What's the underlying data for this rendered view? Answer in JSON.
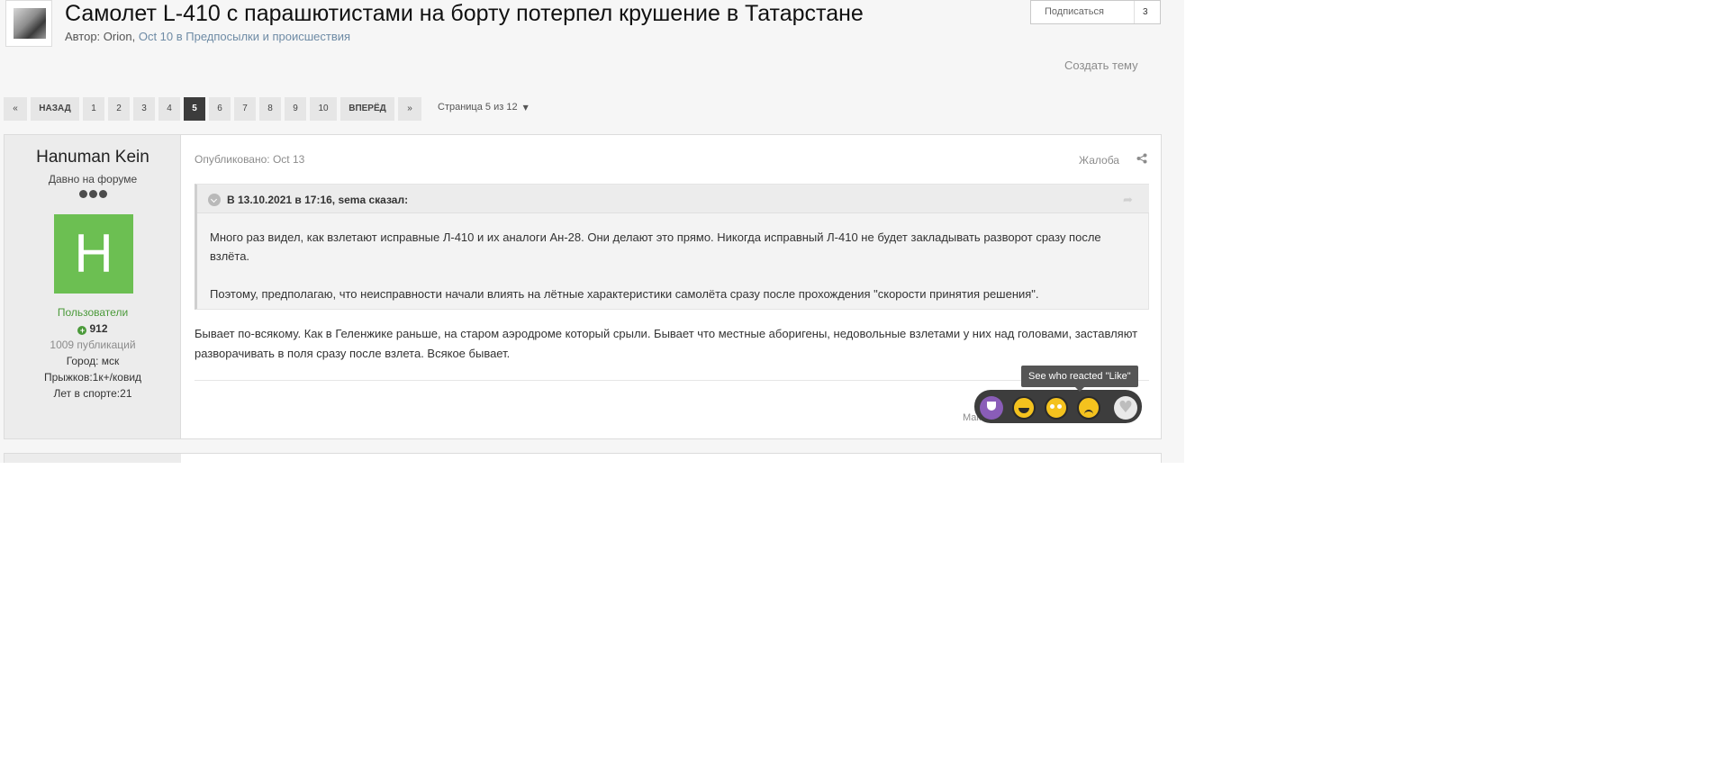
{
  "topic": {
    "title": "Самолет L-410 с парашютистами на борту потерпел крушение в Татарстане",
    "meta_prefix": "Автор: ",
    "author": "Orion",
    "meta_sep": ", ",
    "meta_link": "Oct 10 в Предпосылки и происшествия",
    "follow_label": "Подписаться",
    "follow_count": "3",
    "create_topic": "Создать тему"
  },
  "pagination": {
    "first": "«",
    "prev": "НАЗАД",
    "pages": [
      "1",
      "2",
      "3",
      "4",
      "5",
      "6",
      "7",
      "8",
      "9",
      "10"
    ],
    "current": "5",
    "next": "ВПЕРЁД",
    "last": "»",
    "page_jump": "Страница 5 из 12"
  },
  "post": {
    "author_name": "Hanuman Kein",
    "author_title": "Давно на форуме",
    "avatar_letter": "H",
    "group": "Пользователи",
    "reputation": "912",
    "posts_count": "1009 публикаций",
    "city": "Город: мск",
    "jumps": "Прыжков:1к+/ковид",
    "years": "Лет в спорте:21",
    "date": "Опубликовано: Oct 13",
    "report": "Жалоба",
    "quote_cite": "В 13.10.2021 в 17:16, sema сказал:",
    "quote_p1": "Много раз видел, как взлетают исправные Л-410 и их аналоги Ан-28. Они делают это прямо. Никогда исправный Л-410 не будет закладывать разворот сразу после взлёта.",
    "quote_p2": "Поэтому, предполагаю, что неисправности начали влиять на лётные характеристики самолёта сразу после прохождения \"скорости принятия решения\".",
    "text": "Бывает по-всякому. Как в Геленжике раньше, на старом аэродроме который срыли. Бывает что местные аборигены, недовольные взлетами у них над головами, заставляют разворачивать в поля сразу после взлета. Всякое бывает.",
    "tooltip": "See who reacted \"Like\"",
    "reacted_by": "Максим Ин reacted to this"
  },
  "colors": {
    "accent_green": "#6cbf52",
    "link": "#6e8ba5",
    "active_page": "#3c3c3c"
  }
}
